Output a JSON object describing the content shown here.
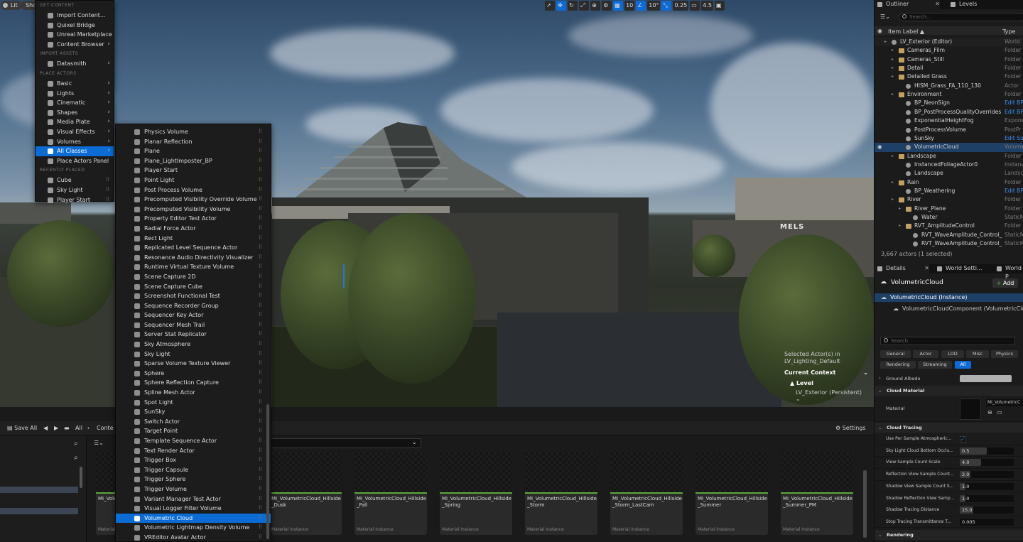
{
  "viewport": {
    "lit_label": "Lit",
    "show_label": "Sho",
    "toolbar": {
      "grid_value": "10",
      "rotation_value": "10°",
      "scale_value": "0.25",
      "camera_speed": "4.5"
    },
    "building_sign": "MELS",
    "selection": {
      "line1": "Selected Actor(s) in",
      "line2": "LV_Lighting_Default",
      "current_context": "Current Context",
      "level_label": "Level",
      "level_value": "LV_Exterior (Persistent)"
    }
  },
  "main_menu": {
    "sections": {
      "get_content": "GET CONTENT",
      "import_assets": "IMPORT ASSETS",
      "place_actors": "PLACE ACTORS",
      "recently_placed": "RECENTLY PLACED"
    },
    "get_content_items": [
      "Import Content...",
      "Quixel Bridge",
      "Unreal Marketplace",
      "Content Browser"
    ],
    "import_items": [
      "Datasmith"
    ],
    "place_items": [
      "Basic",
      "Lights",
      "Cinematic",
      "Shapes",
      "Media Plate",
      "Visual Effects",
      "Volumes",
      "All Classes",
      "Place Actors Panel"
    ],
    "recent_items": [
      "Cube",
      "Sky Light",
      "Player Start"
    ]
  },
  "sub_menu": {
    "items": [
      "Physics Volume",
      "Planar Reflection",
      "Plane",
      "Plane_LightImposter_BP",
      "Player Start",
      "Point Light",
      "Post Process Volume",
      "Precomputed Visibility Override Volume",
      "Precomputed Visibility Volume",
      "Property Editor Test Actor",
      "Radial Force Actor",
      "Rect Light",
      "Replicated Level Sequence Actor",
      "Resonance Audio Directivity Visualizer",
      "Runtime Virtual Texture Volume",
      "Scene Capture 2D",
      "Scene Capture Cube",
      "Screenshot Functional Test",
      "Sequence Recorder Group",
      "Sequencer Key Actor",
      "Sequencer Mesh Trail",
      "Server Stat Replicator",
      "Sky Atmosphere",
      "Sky Light",
      "Sparse Volume Texture Viewer",
      "Sphere",
      "Sphere Reflection Capture",
      "Spline Mesh Actor",
      "Spot Light",
      "SunSky",
      "Switch Actor",
      "Target Point",
      "Template Sequence Actor",
      "Text Render Actor",
      "Trigger Box",
      "Trigger Capsule",
      "Trigger Sphere",
      "Trigger Volume",
      "Variant Manager Test Actor",
      "Visual Logger Filter Volume",
      "Volumetric Cloud",
      "Volumetric Lightmap Density Volume",
      "VREditor Avatar Actor"
    ],
    "selected": "Volumetric Cloud"
  },
  "content_browser": {
    "save_all": "Save All",
    "path_all": "All",
    "path_content": "Conte",
    "settings": "Settings",
    "first_tile_name": "MI_Volu",
    "first_tile_type": "Material",
    "tiles": [
      {
        "name": "MI_VolumetricCloud_Hillside_Dusk",
        "display": "MI_VolumetricCloud_Hillside_\nusk",
        "type": "Material Instance"
      },
      {
        "name": "MI_VolumetricCloud_Hillside_Fall",
        "display": "MI_VolumetricCloud_Hillside_\nFall",
        "type": "Material Instance"
      },
      {
        "name": "MI_VolumetricCloud_Hillside_Spring",
        "display": "MI_VolumetricCloud_Hillside_\nSpring",
        "type": "Material Instance"
      },
      {
        "name": "MI_VolumetricCloud_Hillside_Storm",
        "display": "MI_VolumetricCloud_Hillside_\nStorm",
        "type": "Material Instance"
      },
      {
        "name": "MI_VolumetricCloud_Hillside_Storm_LastCam",
        "display": "MI_VolumetricCloud_Hillside_\nStorm_LastCam",
        "type": "Material Instance"
      },
      {
        "name": "MI_VolumetricCloud_Hillside_Summer",
        "display": "MI_VolumetricCloud_Hillside_\nSummer",
        "type": "Material Instance"
      },
      {
        "name": "MI_VolumetricCloud_Hillside_Summer_PM",
        "display": "MI_VolumetricCloud_Hillside_\nSummer_PM",
        "type": "Material Instance"
      }
    ]
  },
  "outliner": {
    "tab_outliner": "Outliner",
    "tab_levels": "Levels",
    "search_placeholder": "Search...",
    "col_label": "Item Label",
    "col_type": "Type",
    "rows": [
      {
        "label": "LV_Exterior (Editor)",
        "type": "World"
      },
      {
        "label": "Cameras_Film",
        "type": "Folder"
      },
      {
        "label": "Cameras_Still",
        "type": "Folder"
      },
      {
        "label": "Detail",
        "type": "Folder"
      },
      {
        "label": "Detailed Grass",
        "type": "Folder"
      },
      {
        "label": "HISM_Grass_FA_110_130",
        "type": "Actor"
      },
      {
        "label": "Environment",
        "type": "Folder"
      },
      {
        "label": "BP_NeonSign",
        "type": "Edit BP"
      },
      {
        "label": "BP_PostProcessQualityOverrides",
        "type": "Edit BP"
      },
      {
        "label": "ExponentialHeightFog",
        "type": "Expone"
      },
      {
        "label": "PostProcessVolume",
        "type": "PostPr"
      },
      {
        "label": "SunSky",
        "type": "Edit Su"
      },
      {
        "label": "VolumetricCloud",
        "type": "Volume"
      },
      {
        "label": "Landscape",
        "type": "Folder"
      },
      {
        "label": "InstancedFoliageActor0",
        "type": "Instanc"
      },
      {
        "label": "Landscape",
        "type": "Landsc"
      },
      {
        "label": "Rain",
        "type": "Folder"
      },
      {
        "label": "BP_Weathering",
        "type": "Edit BP"
      },
      {
        "label": "River",
        "type": "Folder"
      },
      {
        "label": "River_Plane",
        "type": "Folder"
      },
      {
        "label": "Water",
        "type": "StaticM"
      },
      {
        "label": "RVT_AmplitudeControl",
        "type": "Folder"
      },
      {
        "label": "RVT_WaveAmplitude_Control_",
        "type": "StaticM"
      },
      {
        "label": "RVT_WaveAmplitude_Control_",
        "type": "StaticM"
      }
    ],
    "count": "3,667 actors (1 selected)"
  },
  "details": {
    "tab_details": "Details",
    "tab_world": "World Setti...",
    "tab_world2": "World P",
    "title": "VolumetricCloud",
    "add_label": "Add",
    "instance": "VolumetricCloud (Instance)",
    "component": "VolumetricCloudComponent (VolumetricCloudC",
    "search_placeholder": "Search",
    "filters_row1": [
      "General",
      "Actor",
      "LOD",
      "Misc",
      "Physics"
    ],
    "filters_row2": [
      "Rendering",
      "Streaming",
      "All"
    ],
    "ground_albedo": "Ground Albedo",
    "cloud_material_section": "Cloud Material",
    "material_label": "Material",
    "material_value": "MI_VolumetricC",
    "cloud_tracing_section": "Cloud Tracing",
    "props": [
      {
        "name": "Use Per Sample Atmospheric...",
        "value": "",
        "checkbox": true,
        "fill": 0
      },
      {
        "name": "Sky Light Cloud Bottom Occlu...",
        "value": "0.5",
        "checkbox": false,
        "fill": 0.5
      },
      {
        "name": "View Sample Count Scale",
        "value": "4.0",
        "checkbox": false,
        "fill": 0.4
      },
      {
        "name": "Reflection View Sample Count...",
        "value": "2.0",
        "checkbox": false,
        "fill": 0.2
      },
      {
        "name": "Shadow View Sample Count S...",
        "value": "1.0",
        "checkbox": false,
        "fill": 0.1
      },
      {
        "name": "Shadow Reflection View Samp...",
        "value": "1.0",
        "checkbox": false,
        "fill": 0.1
      },
      {
        "name": "Shadow Tracing Distance",
        "value": "15.0",
        "checkbox": false,
        "fill": 0.25
      },
      {
        "name": "Stop Tracing Transmittance T...",
        "value": "0.005",
        "checkbox": false,
        "fill": 0
      }
    ],
    "rendering_section": "Rendering"
  },
  "colors": {
    "accent": "#0d6bd6",
    "selection_row": "#1e3f66",
    "folder": "#c4a060",
    "asset_bar": "#5aa83a"
  }
}
